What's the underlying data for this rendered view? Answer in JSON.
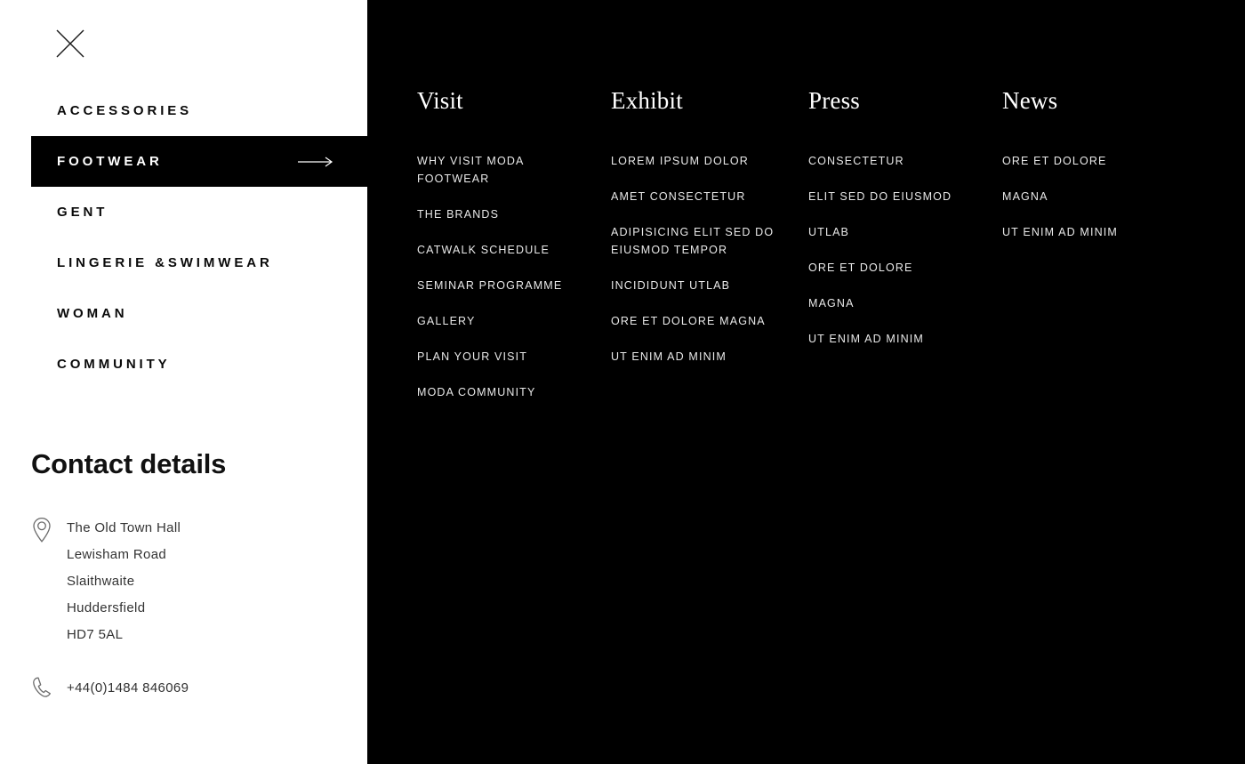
{
  "sidebar": {
    "close_icon": "close-icon",
    "nav_items": [
      {
        "label": "ACCESSORIES",
        "active": false
      },
      {
        "label": "FOOTWEAR",
        "active": true
      },
      {
        "label": "GENT",
        "active": false
      },
      {
        "label": "LINGERIE &SWIMWEAR",
        "active": false
      },
      {
        "label": "WOMAN",
        "active": false
      },
      {
        "label": "COMMUNITY",
        "active": false
      }
    ],
    "active_arrow_icon": "arrow-right-icon",
    "contact": {
      "title": "Contact details",
      "location_icon": "map-pin-icon",
      "address_lines": [
        "The Old Town Hall",
        "Lewisham Road",
        "Slaithwaite",
        "Huddersfield",
        "HD7 5AL"
      ],
      "phone_icon": "phone-icon",
      "phone": "+44(0)1484 846069"
    }
  },
  "mega_menu": {
    "columns": [
      {
        "title": "Visit",
        "links": [
          "WHY VISIT MODA FOOTWEAR",
          "THE BRANDS",
          "CATWALK SCHEDULE",
          "SEMINAR PROGRAMME",
          "GALLERY",
          "PLAN YOUR VISIT",
          "MODA COMMUNITY"
        ]
      },
      {
        "title": "Exhibit",
        "links": [
          "LOREM IPSUM DOLOR",
          "AMET CONSECTETUR",
          "ADIPISICING ELIT SED DO EIUSMOD TEMPOR",
          "INCIDIDUNT UTLAB",
          "ORE ET DOLORE MAGNA",
          "UT ENIM AD MINIM"
        ]
      },
      {
        "title": "Press",
        "links": [
          "CONSECTETUR",
          "ELIT SED DO EIUSMOD",
          "UTLAB",
          "ORE ET DOLORE",
          "MAGNA",
          "UT ENIM AD MINIM"
        ]
      },
      {
        "title": "News",
        "links": [
          "ORE ET DOLORE",
          "MAGNA",
          "UT ENIM AD MINIM"
        ]
      }
    ]
  },
  "colors": {
    "panel_background": "#ffffff",
    "menu_background": "#000000",
    "active_item_background": "#000000",
    "active_item_text": "#ffffff",
    "nav_text": "#0a0a0a",
    "link_text": "#e9e9e9",
    "contact_text": "#333333",
    "icon_stroke": "#6b6b6b"
  }
}
